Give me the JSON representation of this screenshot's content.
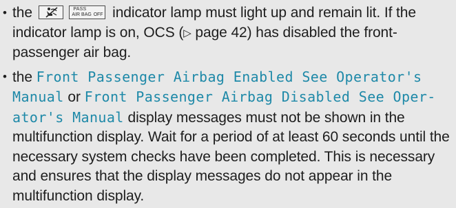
{
  "bullets": [
    {
      "marker": "•",
      "lead": "the",
      "seat_icon": "passenger-airbag-off-icon",
      "pass_indicator": {
        "top": "PASS",
        "bottom": "AIR BAG",
        "right": "OFF"
      },
      "text_1": "indicator lamp must light up and remain lit. If the indicator lamp is on, OCS (",
      "page_ref_symbol": "▷",
      "page_ref_text": "page 42",
      "text_2": ") has disabled the front-passenger air bag."
    },
    {
      "marker": "•",
      "lead": "the",
      "message_1": "Front Passenger Airbag Enabled See Operator's Manual",
      "connector": "or",
      "message_2": "Front Passenger Airbag Disabled See Oper-ator's Manual",
      "text": "display messages must not be shown in the multifunction display. Wait for a period of at least 60 seconds until the necessary system checks have been completed. This is necessary and ensures that the display messages do not appear in the multifunction display."
    }
  ]
}
